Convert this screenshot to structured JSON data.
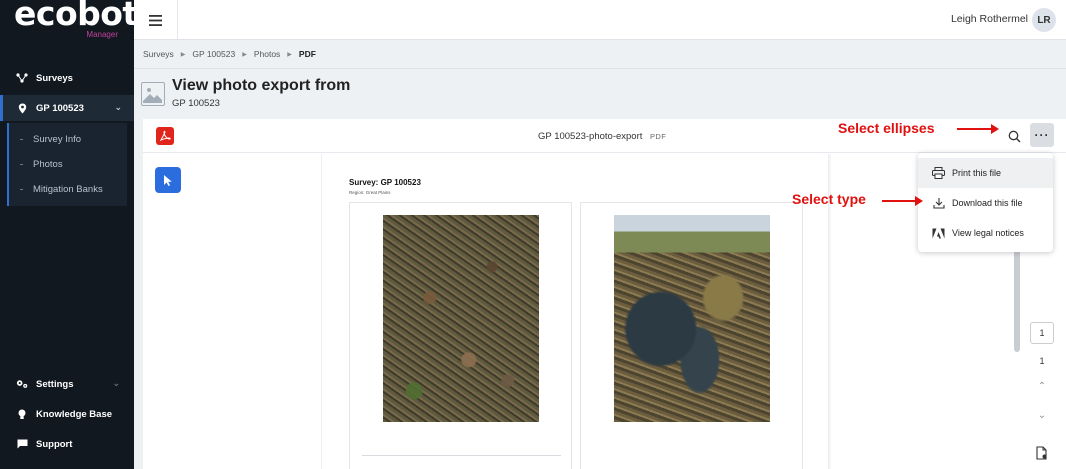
{
  "app": {
    "logo_word": "ecobot",
    "logo_sub": "Manager",
    "brand_accent": "#c0409a",
    "sidebar_bg": "#111820",
    "active_accent": "#2f6fd0"
  },
  "sidebar": {
    "surveys": "Surveys",
    "survey_item": "GP 100523",
    "sub_items": [
      "Survey Info",
      "Photos",
      "Mitigation Banks"
    ],
    "settings": "Settings",
    "knowledge_base": "Knowledge Base",
    "support": "Support"
  },
  "topbar": {
    "user_name": "Leigh Rothermel",
    "avatar_initials": "LR"
  },
  "breadcrumb": [
    "Surveys",
    "GP 100523",
    "Photos",
    "PDF"
  ],
  "header": {
    "title": "View photo export from",
    "subtitle": "GP 100523"
  },
  "viewer": {
    "doc_name": "GP 100523-photo-export",
    "doc_type": "PDF",
    "pdf_color": "#e0261c",
    "page_current": "1",
    "page_total": "1",
    "document": {
      "survey_title": "Survey: GP 100523",
      "region": "Region: Great Plains"
    },
    "menu": {
      "print": "Print this file",
      "download": "Download this file",
      "legal": "View legal notices"
    }
  },
  "annotations": {
    "ellipses": "Select ellipses",
    "type": "Select type",
    "color": "#e0110f"
  }
}
